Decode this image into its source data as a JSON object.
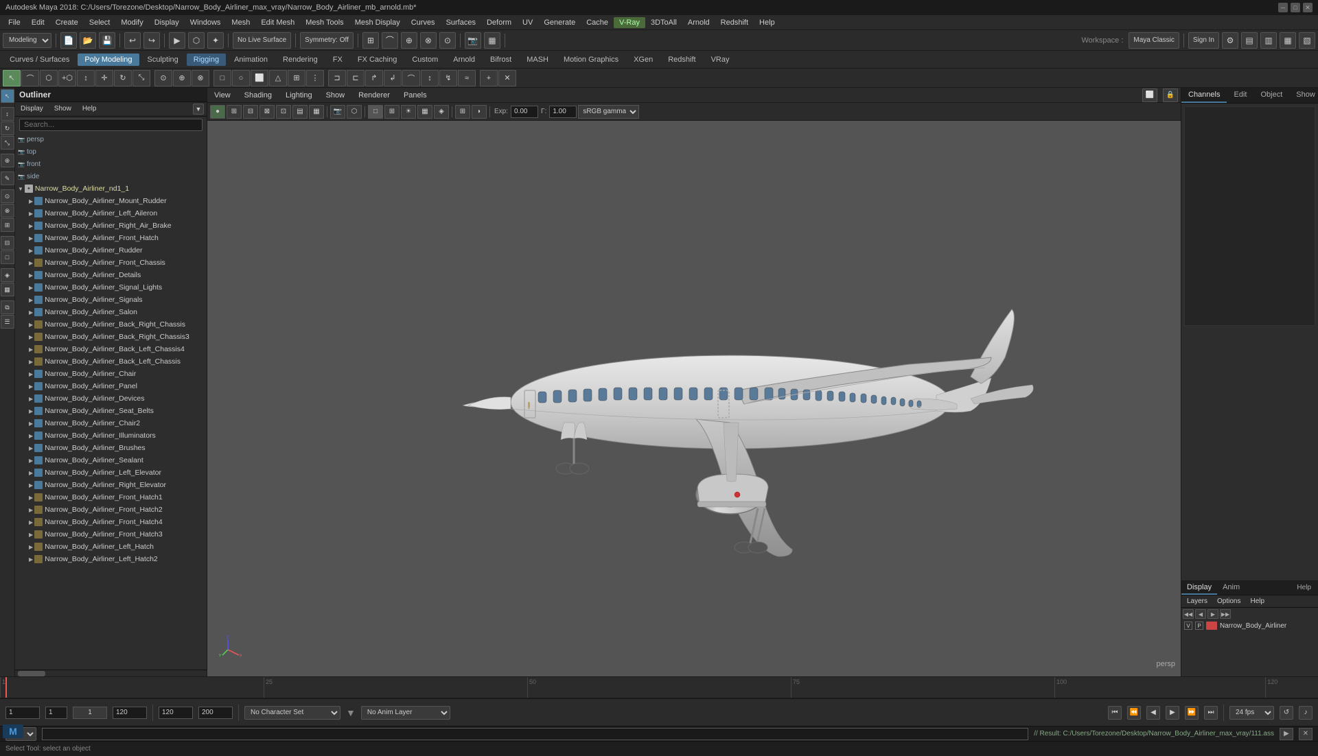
{
  "titlebar": {
    "text": "Autodesk Maya 2018: C:/Users/Torezone/Desktop/Narrow_Body_Airliner_max_vray/Narrow_Body_Airliner_mb_arnold.mb*"
  },
  "menubar": {
    "items": [
      "File",
      "Edit",
      "Create",
      "Select",
      "Modify",
      "Display",
      "Windows",
      "Mesh",
      "Edit Mesh",
      "Mesh Tools",
      "Mesh Display",
      "Curves",
      "Surfaces",
      "Deform",
      "UV",
      "Generate",
      "Cache",
      "V-Ray",
      "3DtoAll",
      "Arnold",
      "Redshift",
      "Help"
    ]
  },
  "toolbar1": {
    "mode_label": "Modeling",
    "no_live_surface": "No Live Surface",
    "symmetry_off": "Symmetry: Off",
    "workspace_label": "Workspace:",
    "workspace_value": "Maya Classic",
    "sign_in": "Sign In"
  },
  "toolbar2": {
    "tabs": [
      "Curves / Surfaces",
      "Poly Modeling",
      "Sculpting",
      "Rigging",
      "Animation",
      "Rendering",
      "FX",
      "FX Caching",
      "Custom",
      "Arnold",
      "Bifrost",
      "MASH",
      "Motion Graphics",
      "XGen",
      "Redshift",
      "VRay"
    ]
  },
  "outliner": {
    "title": "Outliner",
    "menubar": [
      "Display",
      "Show",
      "Help"
    ],
    "search_placeholder": "Search...",
    "items": [
      {
        "label": "persp",
        "type": "camera",
        "depth": 0
      },
      {
        "label": "top",
        "type": "camera",
        "depth": 0
      },
      {
        "label": "front",
        "type": "camera",
        "depth": 0
      },
      {
        "label": "side",
        "type": "camera",
        "depth": 0
      },
      {
        "label": "Narrow_Body_Airliner_nd1_1",
        "type": "group",
        "depth": 0
      },
      {
        "label": "Narrow_Body_Airliner_Mount_Rudder",
        "type": "mesh",
        "depth": 1
      },
      {
        "label": "Narrow_Body_Airliner_Left_Aileron",
        "type": "mesh",
        "depth": 1
      },
      {
        "label": "Narrow_Body_Airliner_Right_Air_Brake",
        "type": "mesh",
        "depth": 1
      },
      {
        "label": "Narrow_Body_Airliner_Front_Hatch",
        "type": "mesh",
        "depth": 1
      },
      {
        "label": "Narrow_Body_Airliner_Rudder",
        "type": "mesh",
        "depth": 1
      },
      {
        "label": "Narrow_Body_Airliner_Front_Chassis",
        "type": "group",
        "depth": 1
      },
      {
        "label": "Narrow_Body_Airliner_Details",
        "type": "mesh",
        "depth": 1
      },
      {
        "label": "Narrow_Body_Airliner_Signal_Lights",
        "type": "mesh",
        "depth": 1
      },
      {
        "label": "Narrow_Body_Airliner_Signals",
        "type": "mesh",
        "depth": 1
      },
      {
        "label": "Narrow_Body_Airliner_Salon",
        "type": "mesh",
        "depth": 1
      },
      {
        "label": "Narrow_Body_Airliner_Back_Right_Chassis",
        "type": "group",
        "depth": 1
      },
      {
        "label": "Narrow_Body_Airliner_Back_Right_Chassis3",
        "type": "group",
        "depth": 1
      },
      {
        "label": "Narrow_Body_Airliner_Back_Left_Chassis4",
        "type": "group",
        "depth": 1
      },
      {
        "label": "Narrow_Body_Airliner_Back_Left_Chassis",
        "type": "group",
        "depth": 1
      },
      {
        "label": "Narrow_Body_Airliner_Chair",
        "type": "mesh",
        "depth": 1
      },
      {
        "label": "Narrow_Body_Airliner_Panel",
        "type": "mesh",
        "depth": 1
      },
      {
        "label": "Narrow_Body_Airliner_Devices",
        "type": "mesh",
        "depth": 1
      },
      {
        "label": "Narrow_Body_Airliner_Seat_Belts",
        "type": "mesh",
        "depth": 1
      },
      {
        "label": "Narrow_Body_Airliner_Chair2",
        "type": "mesh",
        "depth": 1
      },
      {
        "label": "Narrow_Body_Airliner_Illuminators",
        "type": "mesh",
        "depth": 1
      },
      {
        "label": "Narrow_Body_Airliner_Brushes",
        "type": "mesh",
        "depth": 1
      },
      {
        "label": "Narrow_Body_Airliner_Sealant",
        "type": "mesh",
        "depth": 1
      },
      {
        "label": "Narrow_Body_Airliner_Left_Elevator",
        "type": "mesh",
        "depth": 1
      },
      {
        "label": "Narrow_Body_Airliner_Right_Elevator",
        "type": "mesh",
        "depth": 1
      },
      {
        "label": "Narrow_Body_Airliner_Front_Hatch1",
        "type": "mesh",
        "depth": 1
      },
      {
        "label": "Narrow_Body_Airliner_Front_Hatch2",
        "type": "mesh",
        "depth": 1
      },
      {
        "label": "Narrow_Body_Airliner_Front_Hatch4",
        "type": "mesh",
        "depth": 1
      },
      {
        "label": "Narrow_Body_Airliner_Front_Hatch3",
        "type": "mesh",
        "depth": 1
      },
      {
        "label": "Narrow_Body_Airliner_Left_Hatch",
        "type": "mesh",
        "depth": 1
      },
      {
        "label": "Narrow_Body_Airliner_Left_Hatch2",
        "type": "mesh",
        "depth": 1
      }
    ]
  },
  "viewport": {
    "menubar": [
      "View",
      "Shading",
      "Lighting",
      "Show",
      "Renderer",
      "Panels"
    ],
    "label": "persp",
    "srgb_label": "sRGB gamma",
    "gamma_value": "1.00",
    "exposure_value": "0.00"
  },
  "right_panel": {
    "tabs": [
      "Channels",
      "Edit",
      "Object",
      "Show"
    ],
    "active_tab": "Channels"
  },
  "layers_panel": {
    "tabs": [
      "Display",
      "Anim"
    ],
    "menubar": [
      "Layers",
      "Options",
      "Help"
    ],
    "layer_name": "Narrow_Body_Airliner",
    "layer_v": "V",
    "layer_p": "P"
  },
  "timeline": {
    "start": "1",
    "end": "120",
    "current": "1",
    "ticks": [
      "1",
      "25",
      "50",
      "75",
      "100",
      "120"
    ]
  },
  "bottom_controls": {
    "frame_start": "1",
    "frame_current": "1",
    "frame_marker": "1",
    "frame_end_anim": "120",
    "frame_end": "120",
    "frame_max": "200",
    "character_set": "No Character Set",
    "anim_layer": "No Anim Layer",
    "fps": "24 fps"
  },
  "status_bar": {
    "mode": "MEL",
    "result_text": "// Result: C:/Users/Torezone/Desktop/Narrow_Body_Airliner_max_vray/111.ass"
  },
  "help_bar": {
    "text": "Select Tool: select an object"
  }
}
